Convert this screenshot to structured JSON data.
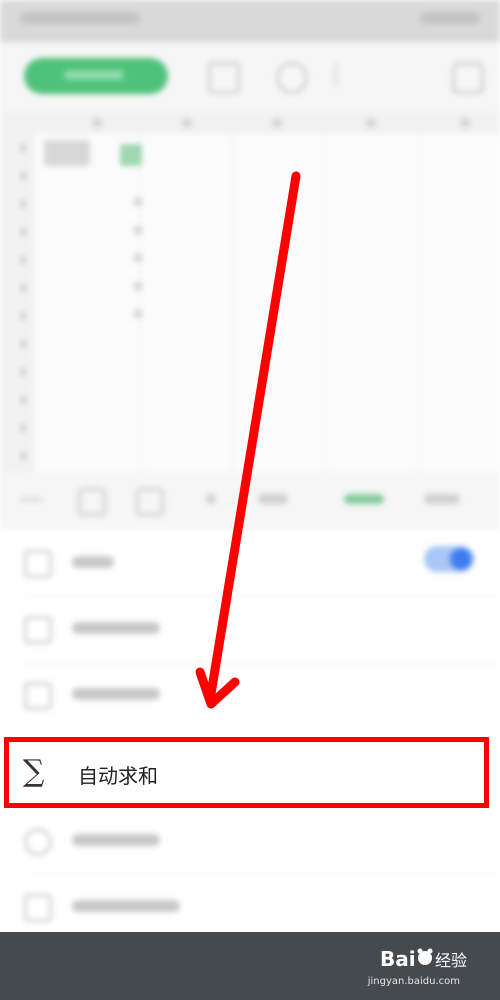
{
  "menu": {
    "highlighted_item": {
      "icon": "sigma-icon",
      "label": "自动求和"
    }
  },
  "watermark": {
    "brand": "Bai 经验",
    "url": "jingyan.baidu.com"
  },
  "colors": {
    "highlight": "#ff0000",
    "accent_green": "#4fc27a",
    "toggle_blue": "#3e7cf0",
    "bottom_bar": "#454a4e"
  }
}
